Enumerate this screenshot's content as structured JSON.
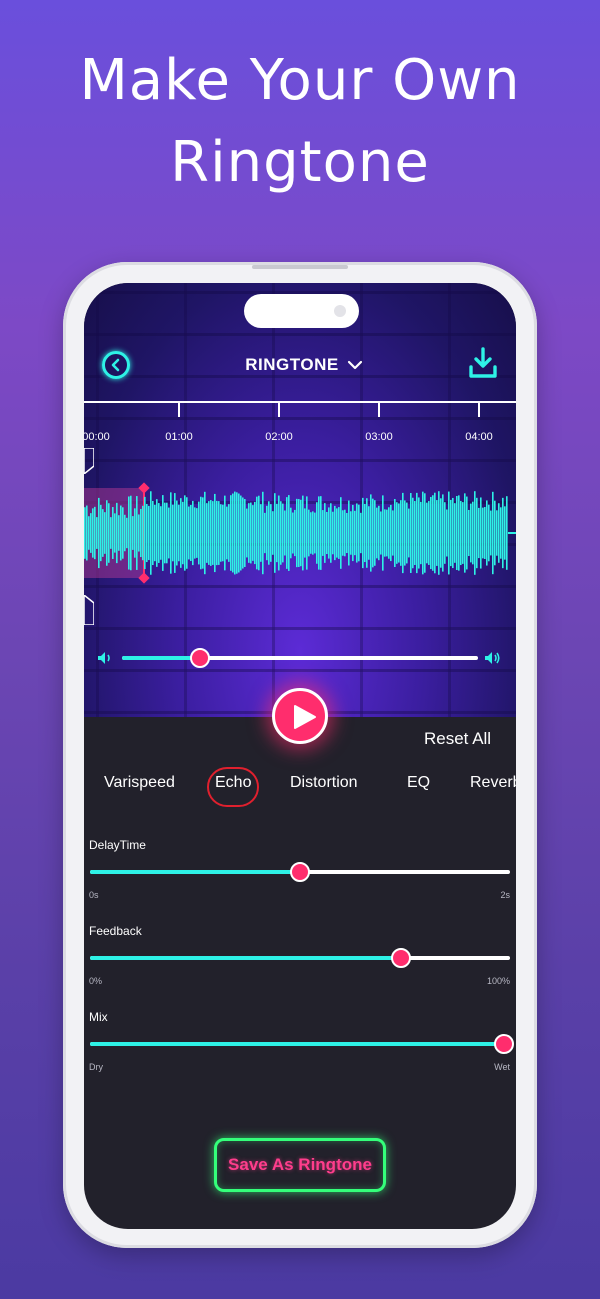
{
  "headline": {
    "line1": "Make Your Own",
    "line2": "Ringtone"
  },
  "header": {
    "title": "RINGTONE",
    "back_icon": "chevron-left-circle-icon",
    "dropdown_icon": "chevron-down-icon",
    "download_icon": "download-icon"
  },
  "timeline": {
    "ticks": [
      "00:00",
      "01:00",
      "02:00",
      "03:00",
      "04:00"
    ]
  },
  "volume": {
    "level": 0.22,
    "min_icon": "speaker-low-icon",
    "max_icon": "speaker-high-icon"
  },
  "controls": {
    "reset_label": "Reset All",
    "play_icon": "play-icon"
  },
  "tabs": {
    "items": [
      "Varispeed",
      "Echo",
      "Distortion",
      "EQ",
      "Reverb"
    ],
    "active": "Echo"
  },
  "params": [
    {
      "label": "DelayTime",
      "min": "0s",
      "max": "2s",
      "value": 0.5
    },
    {
      "label": "Feedback",
      "min": "0%",
      "max": "100%",
      "value": 0.74
    },
    {
      "label": "Mix",
      "min": "Dry",
      "max": "Wet",
      "value": 0.985
    }
  ],
  "save": {
    "label": "Save As Ringtone"
  },
  "colors": {
    "accent_cyan": "#2ef2e6",
    "accent_pink": "#ff2d6d",
    "save_border": "#34ff7a",
    "save_text": "#ff3d8c",
    "panel_bg": "#22212b"
  }
}
